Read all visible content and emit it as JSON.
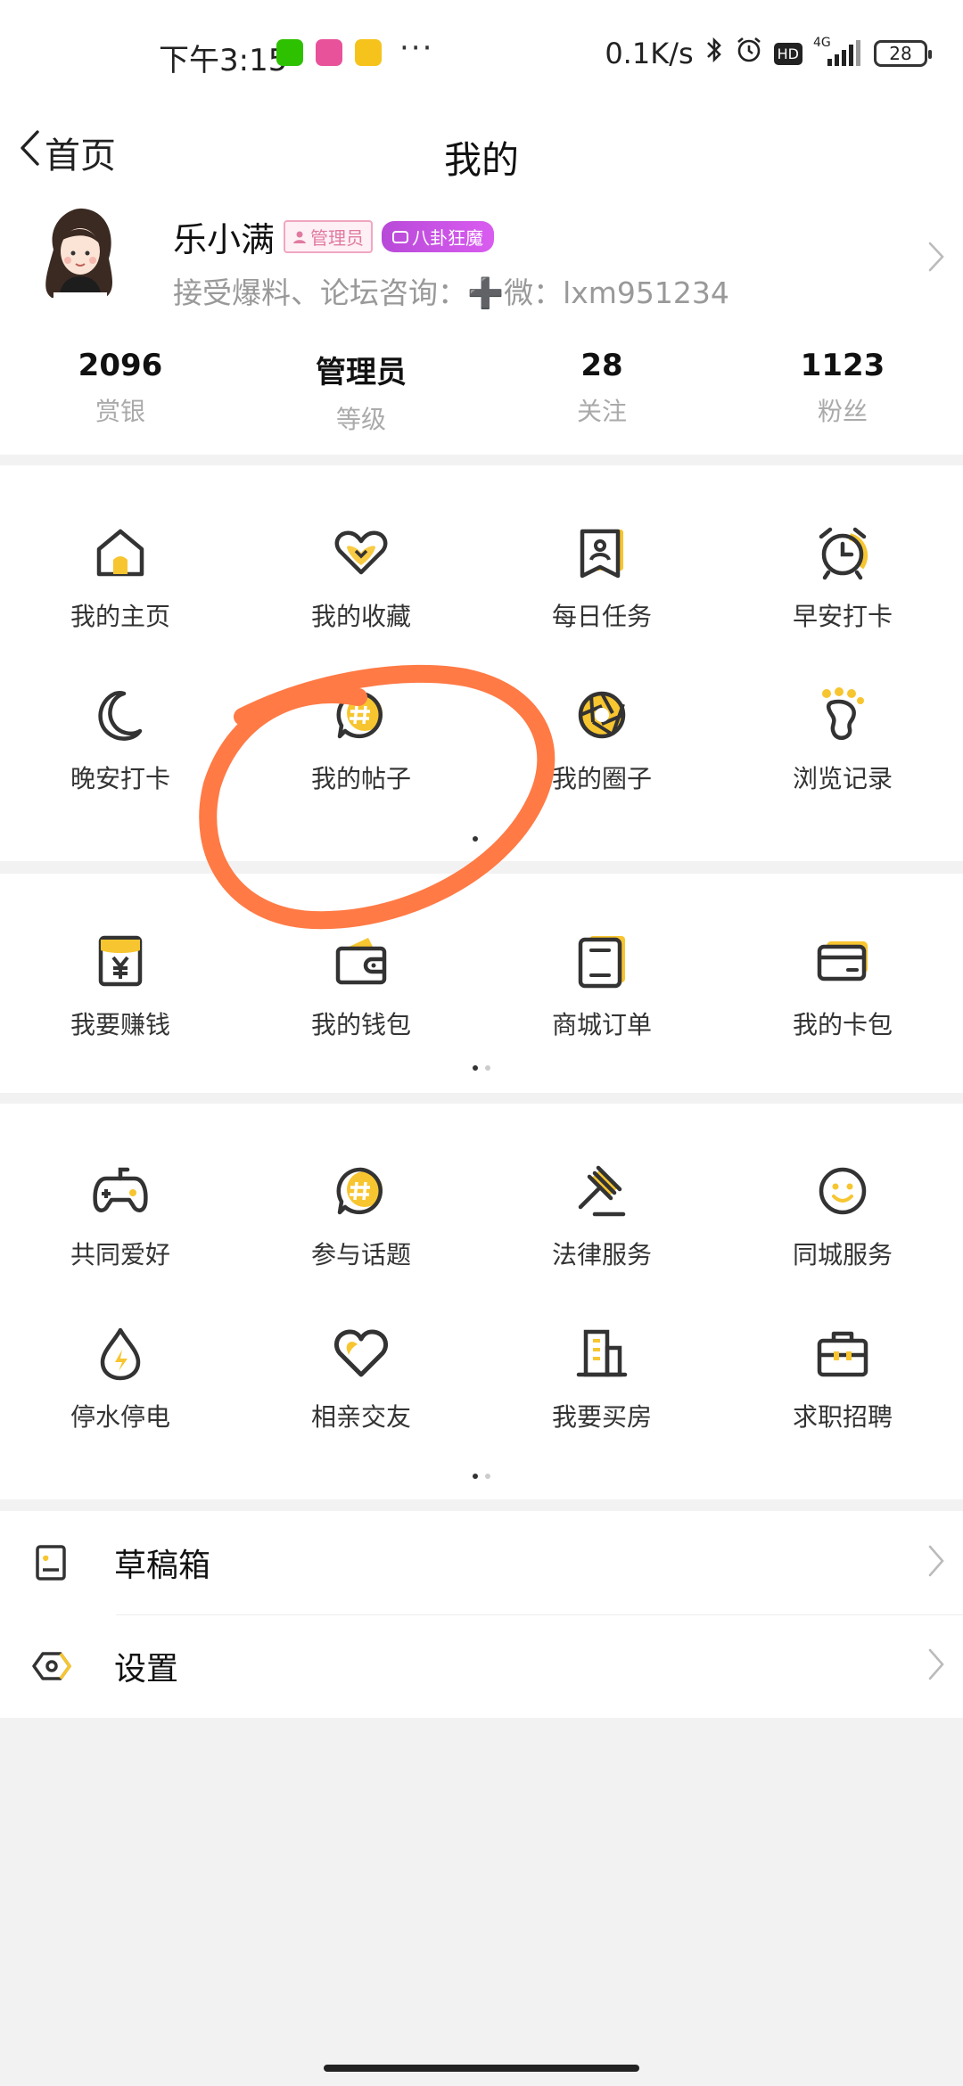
{
  "status_bar": {
    "time": "下午3:15",
    "net_speed": "0.1K/s",
    "hd": "HD",
    "network": "4G",
    "battery": "28",
    "more": "···"
  },
  "nav": {
    "back_label": "首页",
    "title": "我的"
  },
  "profile": {
    "name": "乐小满",
    "badge_admin": "管理员",
    "badge_gossip": "八卦狂魔",
    "bio": "接受爆料、论坛咨询：➕微：lxm951234",
    "stats": [
      {
        "value": "2096",
        "label": "赏银"
      },
      {
        "value": "管理员",
        "label": "等级"
      },
      {
        "value": "28",
        "label": "关注"
      },
      {
        "value": "1123",
        "label": "粉丝"
      }
    ]
  },
  "section1": {
    "items": [
      {
        "label": "我的主页",
        "icon": "home-icon"
      },
      {
        "label": "我的收藏",
        "icon": "heart-favorite-icon"
      },
      {
        "label": "每日任务",
        "icon": "task-bookmark-icon"
      },
      {
        "label": "早安打卡",
        "icon": "alarm-clock-icon"
      },
      {
        "label": "晚安打卡",
        "icon": "moon-icon"
      },
      {
        "label": "我的帖子",
        "icon": "post-hashtag-icon"
      },
      {
        "label": "我的圈子",
        "icon": "aperture-circle-icon"
      },
      {
        "label": "浏览记录",
        "icon": "footprint-icon"
      }
    ]
  },
  "section2": {
    "items": [
      {
        "label": "我要赚钱",
        "icon": "yuan-envelope-icon"
      },
      {
        "label": "我的钱包",
        "icon": "wallet-icon"
      },
      {
        "label": "商城订单",
        "icon": "order-tablet-icon"
      },
      {
        "label": "我的卡包",
        "icon": "card-icon"
      }
    ]
  },
  "section3": {
    "items": [
      {
        "label": "共同爱好",
        "icon": "gamepad-icon"
      },
      {
        "label": "参与话题",
        "icon": "topic-hashtag-icon"
      },
      {
        "label": "法律服务",
        "icon": "gavel-icon"
      },
      {
        "label": "同城服务",
        "icon": "smiley-icon"
      },
      {
        "label": "停水停电",
        "icon": "water-drop-bolt-icon"
      },
      {
        "label": "相亲交友",
        "icon": "heart-icon"
      },
      {
        "label": "我要买房",
        "icon": "building-icon"
      },
      {
        "label": "求职招聘",
        "icon": "briefcase-icon"
      }
    ]
  },
  "list": {
    "drafts": "草稿箱",
    "settings": "设置"
  },
  "colors": {
    "accent": "#f7c52f",
    "ink": "#333333",
    "annotation": "#ff7a45"
  }
}
